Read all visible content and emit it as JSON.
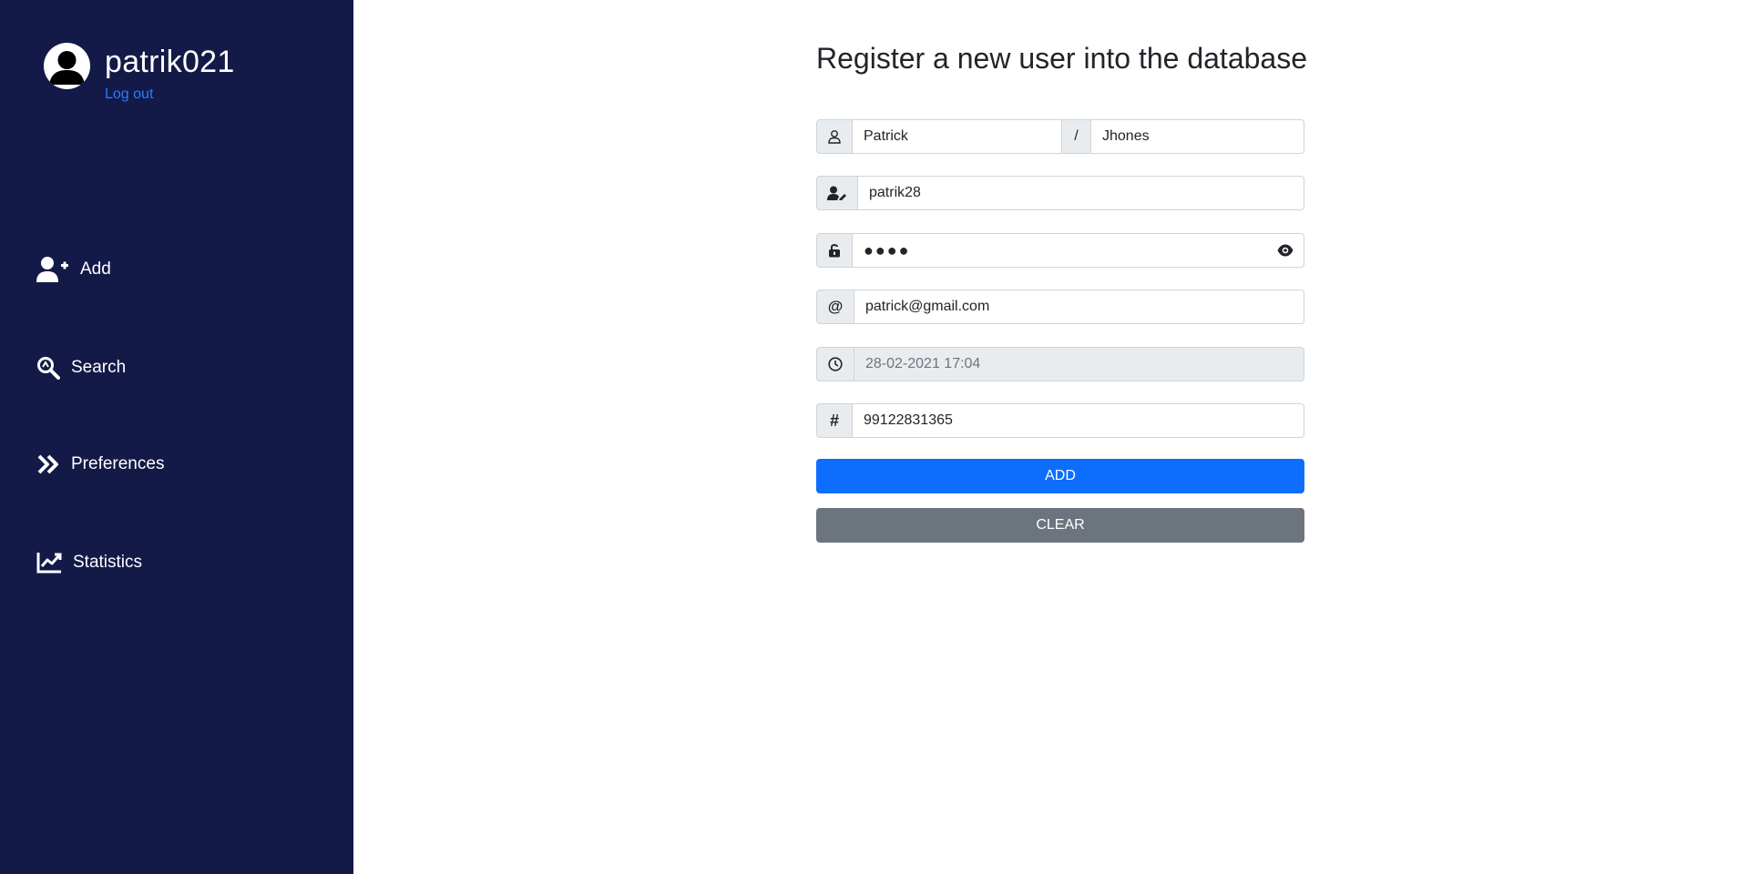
{
  "user": {
    "name": "patrik021",
    "logout_label": "Log out"
  },
  "sidebar": {
    "items": [
      {
        "label": "Add",
        "icon": "user-plus-icon"
      },
      {
        "label": "Search",
        "icon": "search-icon"
      },
      {
        "label": "Preferences",
        "icon": "double-chevron-right-icon"
      },
      {
        "label": "Statistics",
        "icon": "chart-line-icon"
      }
    ]
  },
  "form": {
    "title": "Register a new user into the database",
    "first_name": "Patrick",
    "name_separator": "/",
    "last_name": "Jhones",
    "username": "patrik28",
    "password_masked": "●●●●",
    "email": "patrick@gmail.com",
    "email_addon": "@",
    "datetime": "28-02-2021 17:04",
    "id_addon": "#",
    "id_number": "99122831365",
    "add_label": "ADD",
    "clear_label": "CLEAR"
  },
  "colors": {
    "sidebar_bg": "#131a48",
    "primary": "#0d6efd",
    "secondary": "#6c757d",
    "link": "#2b7bff"
  }
}
